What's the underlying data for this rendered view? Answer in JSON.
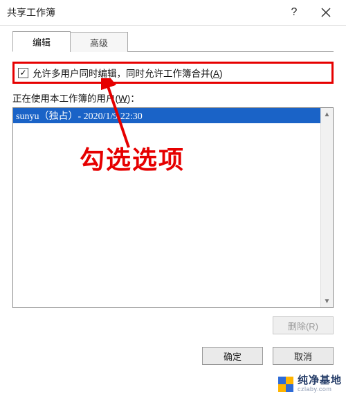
{
  "window": {
    "title": "共享工作簿"
  },
  "tabs": {
    "edit": "编辑",
    "advanced": "高级"
  },
  "checkbox": {
    "label_pre": "允许多用户同时编辑，同时允许工作簿合并(",
    "label_hotkey": "A",
    "label_post": ")",
    "checked": true
  },
  "userlist": {
    "label_pre": "正在使用本工作簿的用户(",
    "label_hotkey": "W",
    "label_post": ")：",
    "items": [
      "sunyu（独占）- 2020/1/9 22:30"
    ]
  },
  "buttons": {
    "remove": "删除(R)",
    "ok": "确定",
    "cancel": "取消"
  },
  "annotation": {
    "text": "勾选选项"
  },
  "watermark": {
    "name": "纯净基地",
    "url": "czlaby.com"
  }
}
